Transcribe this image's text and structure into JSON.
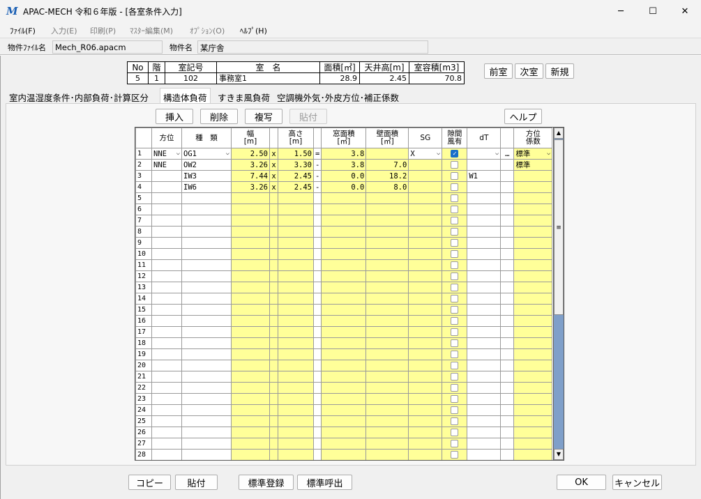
{
  "window": {
    "title": "APAC-MECH 令和６年版 - [各室条件入力]",
    "icon_letter": "M",
    "minimize": "─",
    "maximize": "☐",
    "close": "✕"
  },
  "menu": [
    {
      "label": "ﾌｧｲﾙ(F)",
      "disabled": false
    },
    {
      "label": "入力(E)",
      "disabled": true
    },
    {
      "label": "印刷(P)",
      "disabled": true
    },
    {
      "label": "ﾏｽﾀｰ編集(M)",
      "disabled": true
    },
    {
      "label": "ｵﾌﾟｼｮﾝ(O)",
      "disabled": true
    },
    {
      "label": "ﾍﾙﾌﾟ(H)",
      "disabled": false
    }
  ],
  "file": {
    "file_label": "物件ﾌｧｲﾙ名",
    "file_value": "Mech_R06.apacm",
    "project_label": "物件名",
    "project_value": "某庁舎"
  },
  "room": {
    "headers": [
      "No",
      "階",
      "室記号",
      "室　名",
      "面積[㎡]",
      "天井高[m]",
      "室容積[m3]"
    ],
    "values": [
      "5",
      "1",
      "102",
      "事務室1",
      "28.9",
      "2.45",
      "70.8"
    ]
  },
  "nav_buttons": [
    "前室",
    "次室",
    "新規"
  ],
  "tabs": [
    "室内温湿度条件･内部負荷･計算区分",
    "構造体負荷",
    "すきま風負荷",
    "空調機外気･外皮方位･補正係数"
  ],
  "active_tab": 1,
  "toolbar": {
    "insert": "挿入",
    "delete": "削除",
    "copy": "複写",
    "paste": "貼付",
    "help": "ヘルプ"
  },
  "grid": {
    "headers": [
      "方位",
      "種　類",
      "幅\n[m]",
      "",
      "高さ\n[m]",
      "",
      "窓面積\n[㎡]",
      "壁面積\n[㎡]",
      "SG",
      "隙間\n風有",
      "dT",
      "",
      "方位\n係数"
    ],
    "rows": [
      {
        "no": "1",
        "dir": "NNE",
        "type": "OG1",
        "w": "2.50",
        "x": "x",
        "h": "1.50",
        "op": "=",
        "win": "3.8",
        "wall": "",
        "sg": "X",
        "gap": true,
        "dt": "",
        "dots": "…",
        "coef": "標準"
      },
      {
        "no": "2",
        "dir": "NNE",
        "type": "OW2",
        "w": "3.26",
        "x": "x",
        "h": "3.30",
        "op": "-",
        "win": "3.8",
        "wall": "7.0",
        "sg": "",
        "gap": false,
        "dt": "",
        "dots": "",
        "coef": "標準"
      },
      {
        "no": "3",
        "dir": "",
        "type": "IW3",
        "w": "7.44",
        "x": "x",
        "h": "2.45",
        "op": "-",
        "win": "0.0",
        "wall": "18.2",
        "sg": "",
        "gap": false,
        "dt": "W1",
        "dots": "",
        "coef": ""
      },
      {
        "no": "4",
        "dir": "",
        "type": "IW6",
        "w": "3.26",
        "x": "x",
        "h": "2.45",
        "op": "-",
        "win": "0.0",
        "wall": "8.0",
        "sg": "",
        "gap": false,
        "dt": "",
        "dots": "",
        "coef": ""
      }
    ],
    "empty_row_numbers": [
      "5",
      "6",
      "7",
      "8",
      "9",
      "10",
      "11",
      "12",
      "13",
      "14",
      "15",
      "16",
      "17",
      "18",
      "19",
      "20",
      "21",
      "22",
      "23",
      "24",
      "25",
      "26",
      "27",
      "28"
    ]
  },
  "bottom": {
    "copy": "コピー",
    "paste": "貼付",
    "std_register": "標準登録",
    "std_call": "標準呼出",
    "ok": "OK",
    "cancel": "キャンセル"
  }
}
